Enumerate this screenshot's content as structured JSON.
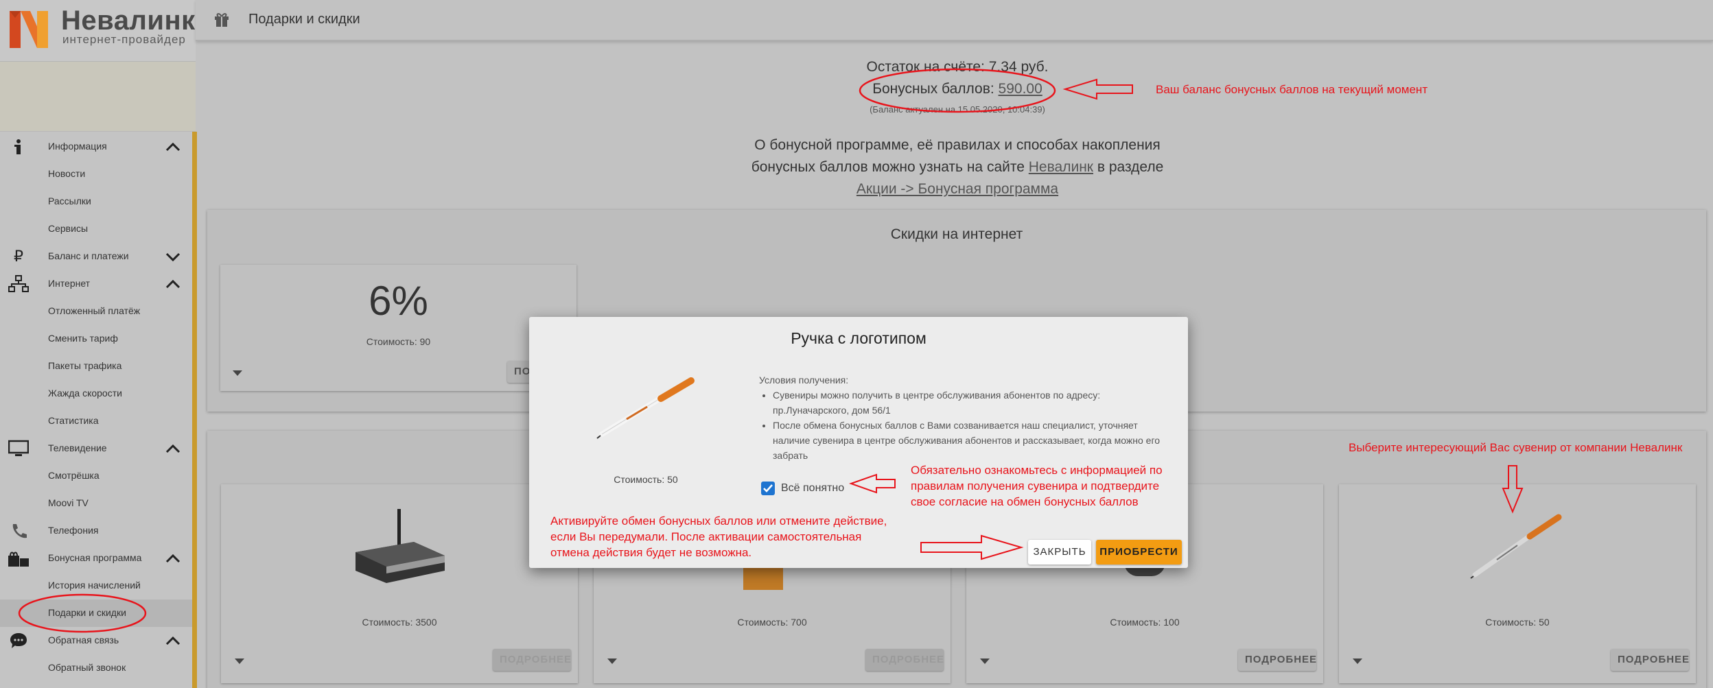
{
  "brand": {
    "name": "Невалинк",
    "tagline": "интернет-провайдер",
    "colors": {
      "accent": "#f39c12",
      "annotation": "#e8141b",
      "checkbox": "#1e74d0",
      "sidebar_stripe": "#c99a2c"
    }
  },
  "header": {
    "title": "Подарки и скидки",
    "icon": "gift-icon"
  },
  "sidebar": {
    "items": [
      {
        "label": "Информация",
        "icon": "info-icon",
        "chevron": "up"
      },
      {
        "label": "Новости"
      },
      {
        "label": "Рассылки"
      },
      {
        "label": "Сервисы"
      },
      {
        "label": "Баланс и платежи",
        "icon": "ruble-icon",
        "chevron": "down"
      },
      {
        "label": "Интернет",
        "icon": "network-icon",
        "chevron": "up"
      },
      {
        "label": "Отложенный платёж"
      },
      {
        "label": "Сменить тариф"
      },
      {
        "label": "Пакеты трафика"
      },
      {
        "label": "Жажда скорости"
      },
      {
        "label": "Статистика"
      },
      {
        "label": "Телевидение",
        "icon": "tv-icon",
        "chevron": "up"
      },
      {
        "label": "Смотрёшка"
      },
      {
        "label": "Moovi TV"
      },
      {
        "label": "Телефония",
        "icon": "phone-icon"
      },
      {
        "label": "Бонусная программа",
        "icon": "gifts-icon",
        "chevron": "up"
      },
      {
        "label": "История начислений"
      },
      {
        "label": "Подарки и скидки",
        "selected": true
      },
      {
        "label": "Обратная связь",
        "icon": "chat-icon",
        "chevron": "up"
      },
      {
        "label": "Обратный звонок"
      }
    ]
  },
  "balance": {
    "account_label": "Остаток на счёте:",
    "account_value": "7.34 руб.",
    "bonus_label": "Бонусных баллов:",
    "bonus_value": "590.00",
    "updated": "(Баланс актуален на 15.05.2020, 10:04:39)"
  },
  "info": {
    "text_1": "О бонусной программе, её правилах и способах накопления",
    "text_2": "бонусных баллов можно узнать на сайте",
    "link_site": "Невалинк",
    "text_3": "в разделе",
    "link_section": "Акции -> Бонусная программа"
  },
  "discounts": {
    "title": "Скидки на интернет",
    "card": {
      "value": "6%",
      "cost": "Стоимость: 90",
      "button": "ПОДРОБНЕЕ",
      "button_visible": "ПОДР"
    }
  },
  "souvenirs": [
    {
      "cost": "Стоимость: 3500",
      "button": "ПОДРОБНЕЕ",
      "enabled": false,
      "icon": "router-icon"
    },
    {
      "cost": "Стоимость: 700",
      "button": "ПОДРОБНЕЕ",
      "enabled": false,
      "icon": "mug-icon"
    },
    {
      "cost": "Стоимость: 100",
      "button": "ПОДРОБНЕЕ",
      "enabled": true,
      "icon": "item-icon"
    },
    {
      "cost": "Стоимость: 50",
      "button": "ПОДРОБНЕЕ",
      "enabled": true,
      "icon": "pen-icon"
    }
  ],
  "modal": {
    "title": "Ручка с логотипом",
    "cost": "Стоимость: 50",
    "conditions_title": "Условия получения:",
    "conditions": [
      "Сувениры можно получить в центре обслуживания абонентов по адресу: пр.Луначарского, дом 56/1",
      "После обмена бонусных баллов с Вами созванивается наш специалист, уточняет наличие сувенира в центре обслуживания абонентов и рассказывает, когда можно его забрать"
    ],
    "checkbox_label": "Всё понятно",
    "checkbox_checked": true,
    "close_button": "ЗАКРЫТЬ",
    "buy_button": "ПРИОБРЕСТИ"
  },
  "annotations": {
    "balance_note": "Ваш баланс бонусных баллов на текущий момент",
    "select_note": "Выберите интересующий Вас сувенир от компании Невалинк",
    "confirm_note_1": "Обязательно ознакомьтесь с информацией по",
    "confirm_note_2": "правилам получения сувенира и подтвердите",
    "confirm_note_3": "свое согласие на обмен бонусных баллов",
    "activate_note_1": "Активируйте обмен бонусных баллов или отмените действие,",
    "activate_note_2": "если Вы передумали. После активации самостоятельная",
    "activate_note_3": "отмена действия будет не возможна."
  }
}
